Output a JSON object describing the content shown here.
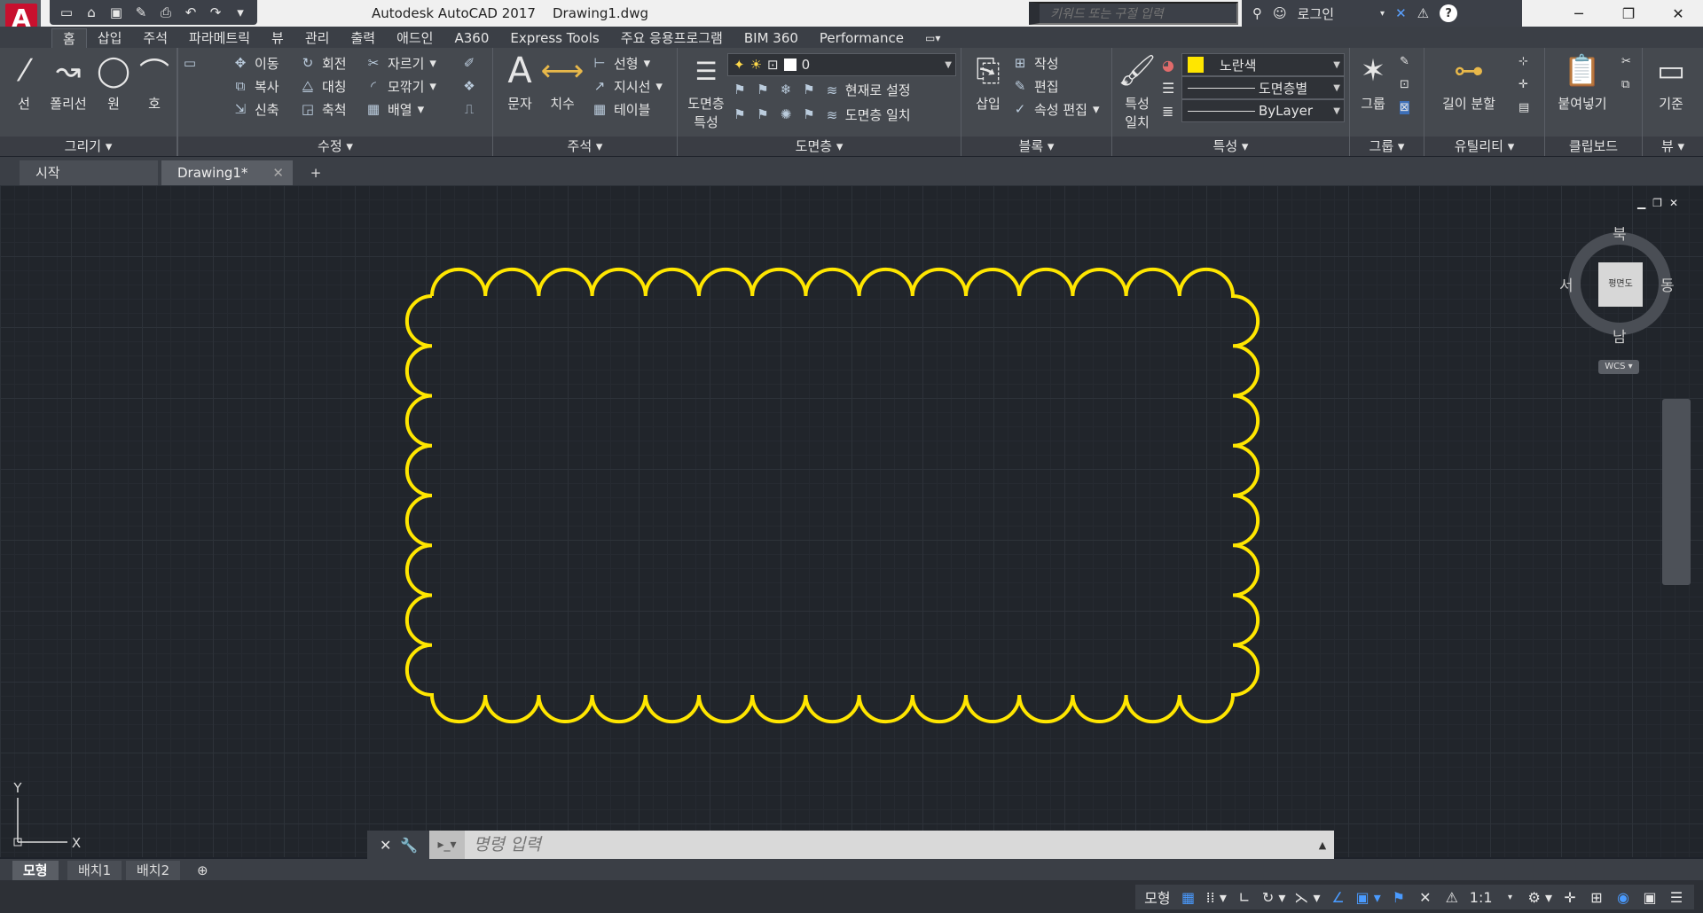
{
  "window": {
    "app": "Autodesk AutoCAD 2017",
    "file": "Drawing1.dwg",
    "search_placeholder": "키워드 또는 구절 입력",
    "login": "로그인"
  },
  "ribbon_tabs": [
    "홈",
    "삽입",
    "주석",
    "파라메트릭",
    "뷰",
    "관리",
    "출력",
    "애드인",
    "A360",
    "Express Tools",
    "주요 응용프로그램",
    "BIM 360",
    "Performance"
  ],
  "panels": {
    "draw": {
      "title": "그리기",
      "line": "선",
      "polyline": "폴리선",
      "circle": "원",
      "arc": "호"
    },
    "modify": {
      "title": "수정",
      "move": "이동",
      "rotate": "회전",
      "trim": "자르기",
      "copy": "복사",
      "mirror": "대칭",
      "fillet": "모깎기",
      "stretch": "신축",
      "scale": "축척",
      "array": "배열"
    },
    "annotation": {
      "title": "주석",
      "text": "문자",
      "dimension": "치수",
      "linear": "선형",
      "leader": "지시선",
      "table": "테이블"
    },
    "layers": {
      "title": "도면층",
      "properties": "도면층\n특성",
      "properties_l1": "도면층",
      "properties_l2": "특성",
      "current_layer": "0",
      "set_current": "현재로 설정",
      "match_layer": "도면층 일치"
    },
    "block": {
      "title": "블록",
      "insert": "삽입",
      "create": "작성",
      "edit": "편집",
      "edit_attr": "속성 편집"
    },
    "properties": {
      "title": "특성",
      "match_l1": "특성",
      "match_l2": "일치",
      "color": "노란색",
      "linetype": "도면층별",
      "lineweight": "ByLayer"
    },
    "groups": {
      "title": "그룹",
      "group": "그룹"
    },
    "utilities": {
      "title": "유틸리티",
      "measure": "길이 분할"
    },
    "clipboard": {
      "title": "클립보드",
      "paste": "붙여넣기"
    },
    "view": {
      "title": "뷰",
      "base": "기준"
    }
  },
  "file_tabs": {
    "start": "시작",
    "drawing": "Drawing1*"
  },
  "viewcube": {
    "north": "북",
    "south": "남",
    "east": "동",
    "west": "서",
    "face": "평면도",
    "wcs": "WCS"
  },
  "ucs": {
    "x": "X",
    "y": "Y"
  },
  "command": {
    "placeholder": "명령 입력"
  },
  "layout_tabs": {
    "model": "모형",
    "layout1": "배치1",
    "layout2": "배치2"
  },
  "status": {
    "model": "모형",
    "scale": "1:1"
  },
  "colors": {
    "cloud": "#ffe600",
    "accent": "#4a9bff",
    "logo": "#c8102e"
  }
}
